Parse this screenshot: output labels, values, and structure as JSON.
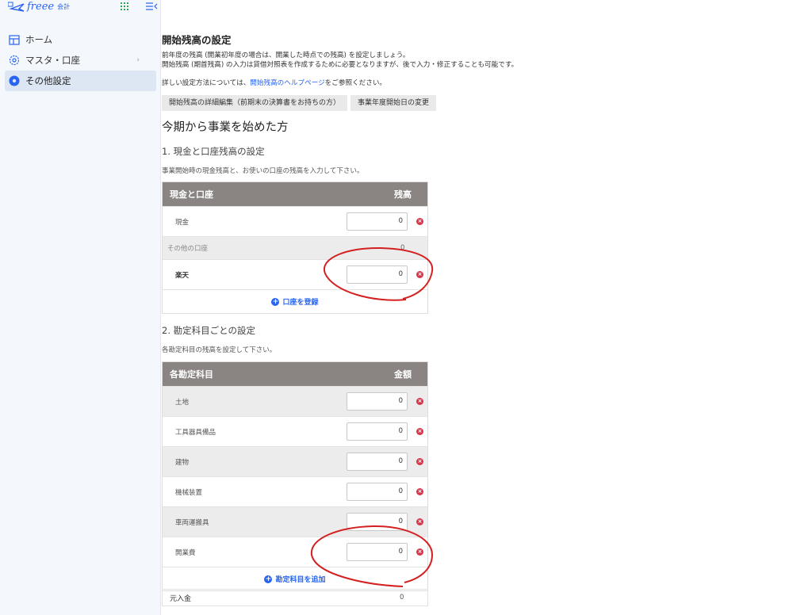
{
  "sidebar": {
    "logo_text": "freee",
    "logo_sub": "会計",
    "items": [
      {
        "label": "ホーム"
      },
      {
        "label": "マスタ・口座"
      },
      {
        "label": "その他設定"
      }
    ]
  },
  "main": {
    "title": "開始残高の設定",
    "desc1": "前年度の残高 (開業初年度の場合は、開業した時点での残高) を設定しましょう。",
    "desc2": "開始残高 (期首残高) の入力は貸借対照表を作成するために必要となりますが、後で入力・修正することも可能です。",
    "help_prefix": "詳しい設定方法については、",
    "help_link": "開始残高のヘルプページ",
    "help_suffix": "をご参照ください。",
    "tabs": [
      {
        "label": "開始残高の詳細編集（前期末の決算書をお持ちの方）"
      },
      {
        "label": "事業年度開始日の変更"
      }
    ],
    "section_title": "今期から事業を始めた方",
    "section1": {
      "title": "1. 現金と口座残高の設定",
      "desc": "事業開始時の現金残高と、お使いの口座の残高を入力して下さい。",
      "col1": "現金と口座",
      "col2": "残高",
      "cash_label": "現金",
      "cash_value": "0",
      "other_label": "その他の口座",
      "other_value": "0",
      "account_label": "楽天",
      "account_value": "0",
      "add_label": "口座を登録"
    },
    "section2": {
      "title": "2. 勘定科目ごとの設定",
      "desc": "各勘定科目の残高を設定して下さい。",
      "col1": "各勘定科目",
      "col2": "金額",
      "rows": [
        {
          "label": "土地",
          "value": "0"
        },
        {
          "label": "工具器具備品",
          "value": "0"
        },
        {
          "label": "建物",
          "value": "0"
        },
        {
          "label": "機械装置",
          "value": "0"
        },
        {
          "label": "車両運搬具",
          "value": "0"
        },
        {
          "label": "開業費",
          "value": "0"
        }
      ],
      "add_label": "勘定科目を追加",
      "footer_label": "元入金",
      "footer_value": "0"
    }
  },
  "colors": {
    "brand": "#2864f0",
    "table_header": "#8a8583",
    "delete": "#d8344a",
    "annotation": "#d42020"
  }
}
